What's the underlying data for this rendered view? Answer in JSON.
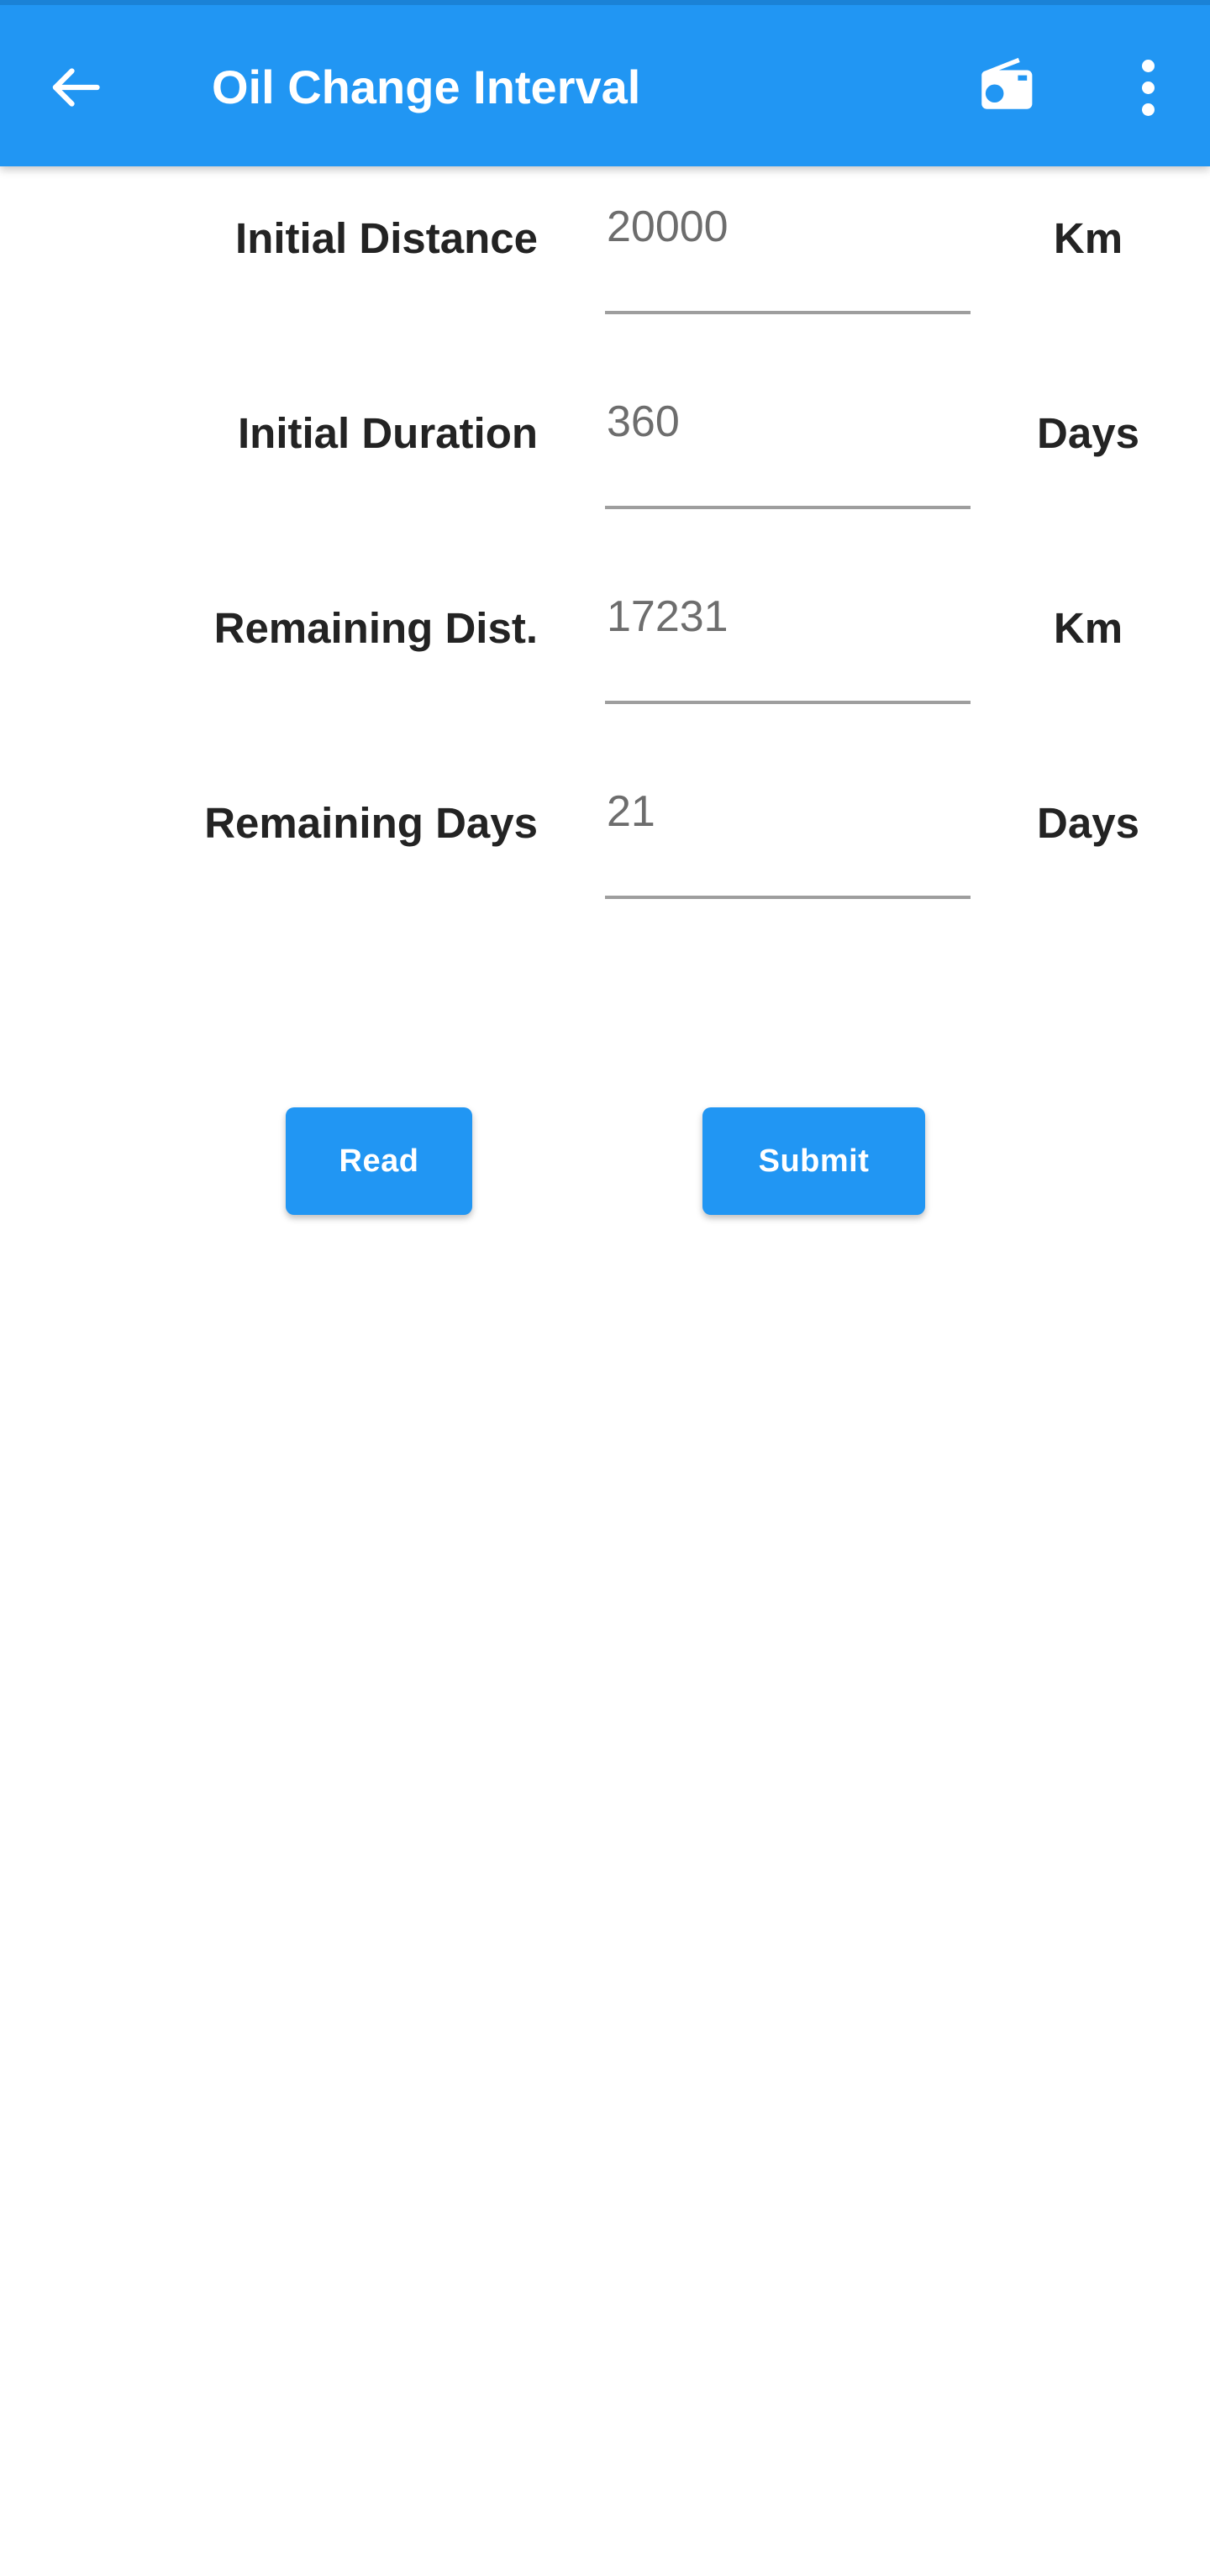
{
  "appbar": {
    "title": "Oil Change Interval",
    "background_color": "#2196f3",
    "back_icon": "arrow-left-icon",
    "radio_icon": "radio-icon",
    "overflow_icon": "more-vertical-icon"
  },
  "form": {
    "rows": [
      {
        "label": "Initial Distance",
        "value": "20000",
        "placeholder": "20000",
        "unit": "Km"
      },
      {
        "label": "Initial Duration",
        "value": "360",
        "placeholder": "360",
        "unit": "Days"
      },
      {
        "label": "Remaining Dist.",
        "value": "17231",
        "placeholder": "17231",
        "unit": "Km"
      },
      {
        "label": "Remaining Days",
        "value": "21",
        "placeholder": "21",
        "unit": "Days"
      }
    ]
  },
  "buttons": {
    "read_label": "Read",
    "submit_label": "Submit",
    "accent_color": "#2196f3"
  }
}
